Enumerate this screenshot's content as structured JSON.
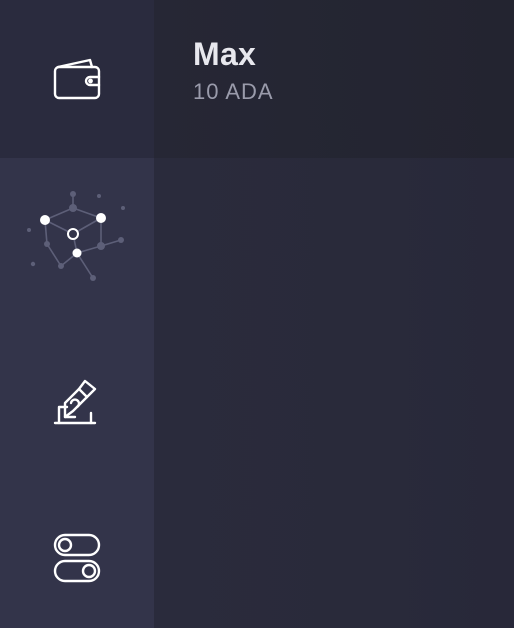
{
  "sidebar": {
    "items": [
      {
        "id": "wallet",
        "icon": "wallet-icon",
        "active": true
      },
      {
        "id": "network",
        "icon": "network-icon",
        "active": false
      },
      {
        "id": "voting",
        "icon": "vote-icon",
        "active": false
      },
      {
        "id": "settings",
        "icon": "toggles-icon",
        "active": false
      }
    ]
  },
  "wallet": {
    "name": "Max",
    "balance": "10 ADA"
  },
  "colors": {
    "sidebar_bg": "#33344a",
    "sidebar_active_bg": "#2a2b3e",
    "header_bg": "#252633",
    "main_bg": "#292a3a",
    "text_primary": "#e8e8ee",
    "text_secondary": "#9a9bab",
    "icon_stroke": "#ffffff"
  }
}
